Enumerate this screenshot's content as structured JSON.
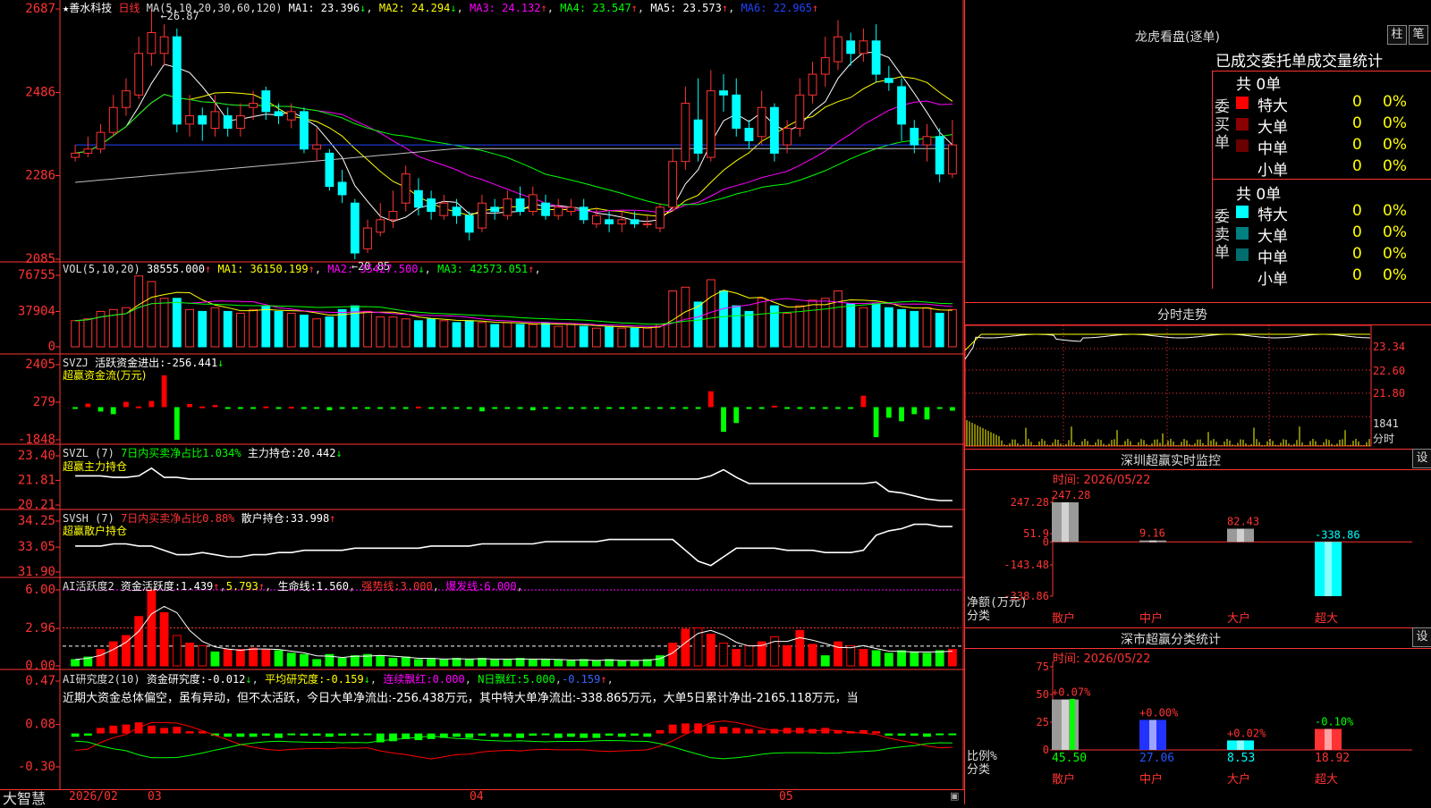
{
  "app": {
    "brand": "大智慧",
    "date_start": "2026/02",
    "months": [
      "03",
      "04",
      "05"
    ]
  },
  "price_pane": {
    "stock": "★善水科技",
    "period": "日线",
    "ma_label": "MA(5,10,20,30,60,120)",
    "ma": [
      {
        "k": "MA1:",
        "v": "23.396",
        "arrow": "↓",
        "color": "#ffffff"
      },
      {
        "k": "MA2:",
        "v": "24.294",
        "arrow": "↓",
        "color": "#ffff00"
      },
      {
        "k": "MA3:",
        "v": "24.132",
        "arrow": "↑",
        "color": "#ff00ff"
      },
      {
        "k": "MA4:",
        "v": "23.547",
        "arrow": "↑",
        "color": "#00ff00"
      },
      {
        "k": "MA5:",
        "v": "23.573",
        "arrow": "↑",
        "color": "#ffffff"
      },
      {
        "k": "MA6:",
        "v": "22.965",
        "arrow": "↑",
        "color": "#2244ff"
      }
    ],
    "y_ticks": [
      "2687",
      "2486",
      "2286",
      "2085"
    ],
    "high_label": "26.87",
    "low_label": "←20.85"
  },
  "vol_pane": {
    "label": "VOL(5,10,20)",
    "value": "38555.000",
    "ma": [
      {
        "k": "MA1:",
        "v": "36150.199",
        "arrow": "↑",
        "color": "#ffff00"
      },
      {
        "k": "MA2:",
        "v": "35427.500",
        "arrow": "↓",
        "color": "#ff00ff"
      },
      {
        "k": "MA3:",
        "v": "42573.051",
        "arrow": "↑",
        "color": "#00ff00"
      }
    ],
    "y_ticks": [
      "76755",
      "37904",
      "0"
    ]
  },
  "svzj_pane": {
    "name": "SVZJ",
    "label": "活跃资金进出:",
    "value": "-256.441",
    "arrow": "↓",
    "subtitle": "超赢资金流(万元)",
    "y_ticks": [
      "2405",
      "279",
      "-1848"
    ]
  },
  "svzl_pane": {
    "name": "SVZL",
    "period": "(7)",
    "desc": "7日内买卖净占比1.034%",
    "k": "主力持仓:",
    "v": "20.442",
    "arrow": "↓",
    "subtitle": "超赢主力持仓",
    "y_ticks": [
      "23.40",
      "21.81",
      "20.21"
    ]
  },
  "svsh_pane": {
    "name": "SVSH",
    "period": "(7)",
    "desc": "7日内买卖净占比0.88%",
    "k": "散户持仓:",
    "v": "33.998",
    "arrow": "↑",
    "subtitle": "超赢散户持仓",
    "y_ticks": [
      "34.25",
      "33.05",
      "31.90"
    ]
  },
  "ai_active_pane": {
    "name": "AI活跃度2",
    "k1": "资金活跃度:",
    "v1": "1.439",
    "v1b": "5.793",
    "k2": "生命线:",
    "v2": "1.560",
    "k3": "强势线:",
    "v3": "3.000",
    "k4": "爆发线:",
    "v4": "6.000",
    "y_ticks": [
      "6.00",
      "2.96",
      "0.00"
    ]
  },
  "ai_research_pane": {
    "name": "AI研究度2(10)",
    "k1": "资金研究度:",
    "v1": "-0.012",
    "k2": "平均研究度:",
    "v2": "-0.159",
    "k3": "连续飘红:",
    "v3": "0.000",
    "k4": "N日飘红:",
    "v4": "5.000",
    "v5": "-0.159",
    "narrative": "近期大资金总体偏空，虽有异动，但不太活跃，今日大单净流出:-256.438万元，其中特大单净流出:-338.865万元，大单5日累计净出-2165.118万元，当",
    "y_ticks": [
      "0.47",
      "0.08",
      "-0.30"
    ]
  },
  "dragon_panel": {
    "title": "龙虎看盘(逐单)",
    "btn_bar": "柱",
    "btn_pen": "笔",
    "header": "已成交委托单成交量统计",
    "buy_side": {
      "label": "委买单",
      "count": "共 0单",
      "rows": [
        {
          "name": "特大",
          "color": "#ff0000",
          "val": "0",
          "pct": "0%"
        },
        {
          "name": "大单",
          "color": "#8b0000",
          "val": "0",
          "pct": "0%"
        },
        {
          "name": "中单",
          "color": "#6a0000",
          "val": "0",
          "pct": "0%"
        },
        {
          "name": "小单",
          "color": "#000000",
          "val": "0",
          "pct": "0%"
        }
      ]
    },
    "sell_side": {
      "label": "委卖单",
      "count": "共 0单",
      "rows": [
        {
          "name": "特大",
          "color": "#00ffff",
          "val": "0",
          "pct": "0%"
        },
        {
          "name": "大单",
          "color": "#008080",
          "val": "0",
          "pct": "0%"
        },
        {
          "name": "中单",
          "color": "#006e6e",
          "val": "0",
          "pct": "0%"
        },
        {
          "name": "小单",
          "color": "#000000",
          "val": "0",
          "pct": "0%"
        }
      ]
    }
  },
  "intraday": {
    "title": "分时走势",
    "y_ticks": [
      "23.34",
      "22.60",
      "21.80"
    ],
    "vol_label": "1841",
    "vol_unit": "分时"
  },
  "sz_monitor": {
    "title": "深圳超赢实时监控",
    "btn": "设",
    "time_label": "时间: 2026/05/22",
    "y_ticks": [
      "247.28",
      "51.9",
      "0",
      "-143.48",
      "-338.86"
    ],
    "unit1": "净额(万元)",
    "unit2": "分类",
    "cats": [
      "散户",
      "中户",
      "大户",
      "超大"
    ],
    "vals": [
      247.28,
      9.16,
      82.43,
      -338.86
    ],
    "val_labels": [
      "247.28",
      "9.16",
      "82.43",
      "-338.86"
    ]
  },
  "sz_stats": {
    "title": "深市超赢分类统计",
    "btn": "设",
    "time_label": "时间: 2026/05/22",
    "y_ticks": [
      "75",
      "50",
      "25",
      "0"
    ],
    "unit1": "比例%",
    "unit2": "分类",
    "cats": [
      "散户",
      "中户",
      "大户",
      "超大"
    ],
    "vals": [
      45.5,
      27.06,
      8.53,
      18.92
    ],
    "val_labels": [
      "45.50",
      "27.06",
      "8.53",
      "18.92"
    ],
    "changes": [
      "+0.07%",
      "+0.00%",
      "+0.02%",
      "-0.10%"
    ]
  },
  "chart_data": {
    "type": "candlestick",
    "title": "★善水科技 日线",
    "x_labels": [
      "2026/02",
      "03",
      "04",
      "05"
    ],
    "price_ylim": [
      20.85,
      26.87
    ],
    "candles": [
      [
        23.3,
        23.4,
        23.6,
        23.2
      ],
      [
        23.4,
        23.5,
        23.8,
        23.3
      ],
      [
        23.5,
        23.9,
        24.1,
        23.4
      ],
      [
        23.9,
        24.5,
        24.8,
        23.8
      ],
      [
        24.5,
        24.9,
        25.2,
        24.3
      ],
      [
        24.8,
        25.8,
        26.2,
        24.7
      ],
      [
        25.8,
        26.3,
        26.87,
        25.5
      ],
      [
        25.8,
        26.2,
        26.5,
        25.5
      ],
      [
        26.2,
        24.1,
        26.4,
        23.9
      ],
      [
        24.1,
        24.3,
        24.8,
        23.8
      ],
      [
        24.3,
        24.1,
        24.5,
        23.7
      ],
      [
        24.0,
        24.4,
        24.8,
        23.8
      ],
      [
        24.3,
        24.0,
        24.5,
        23.8
      ],
      [
        24.0,
        24.3,
        24.6,
        23.8
      ],
      [
        24.5,
        24.6,
        24.9,
        24.2
      ],
      [
        24.9,
        24.4,
        25.0,
        24.2
      ],
      [
        24.4,
        24.3,
        24.6,
        24.1
      ],
      [
        24.2,
        24.4,
        24.6,
        24.0
      ],
      [
        24.4,
        23.5,
        24.5,
        23.4
      ],
      [
        23.5,
        23.6,
        24.0,
        23.2
      ],
      [
        23.4,
        22.6,
        23.5,
        22.5
      ],
      [
        22.7,
        22.4,
        23.0,
        22.2
      ],
      [
        22.2,
        21.0,
        22.3,
        20.85
      ],
      [
        21.1,
        21.6,
        21.8,
        21.0
      ],
      [
        21.5,
        21.8,
        22.2,
        21.4
      ],
      [
        21.8,
        22.0,
        22.5,
        21.6
      ],
      [
        22.2,
        22.9,
        23.1,
        22.0
      ],
      [
        22.5,
        22.1,
        22.8,
        21.9
      ],
      [
        22.3,
        22.0,
        22.5,
        21.8
      ],
      [
        21.9,
        22.2,
        22.4,
        21.8
      ],
      [
        22.1,
        21.9,
        22.3,
        21.7
      ],
      [
        21.9,
        21.5,
        22.0,
        21.3
      ],
      [
        21.6,
        22.2,
        22.4,
        21.5
      ],
      [
        22.1,
        22.0,
        22.3,
        21.8
      ],
      [
        21.9,
        22.3,
        22.5,
        21.8
      ],
      [
        22.3,
        22.0,
        22.6,
        21.9
      ],
      [
        22.0,
        22.4,
        22.6,
        21.9
      ],
      [
        22.2,
        21.9,
        22.4,
        21.8
      ],
      [
        21.9,
        22.1,
        22.3,
        21.8
      ],
      [
        22.0,
        22.1,
        22.3,
        21.9
      ],
      [
        22.1,
        21.8,
        22.3,
        21.7
      ],
      [
        21.7,
        21.9,
        22.1,
        21.6
      ],
      [
        21.8,
        21.7,
        22.0,
        21.5
      ],
      [
        21.7,
        21.8,
        22.0,
        21.5
      ],
      [
        21.8,
        21.7,
        22.0,
        21.6
      ],
      [
        21.7,
        21.7,
        21.9,
        21.6
      ],
      [
        21.6,
        22.1,
        22.2,
        21.5
      ],
      [
        22.1,
        23.2,
        23.5,
        22.0
      ],
      [
        23.2,
        24.6,
        25.0,
        23.0
      ],
      [
        24.2,
        23.4,
        25.2,
        23.2
      ],
      [
        23.3,
        24.9,
        25.4,
        23.2
      ],
      [
        24.9,
        24.8,
        25.3,
        24.4
      ],
      [
        24.8,
        24.0,
        25.2,
        23.8
      ],
      [
        24.0,
        23.7,
        24.2,
        23.5
      ],
      [
        23.8,
        24.5,
        24.9,
        23.6
      ],
      [
        24.5,
        23.4,
        24.6,
        23.2
      ],
      [
        23.6,
        24.0,
        24.2,
        23.4
      ],
      [
        24.0,
        24.8,
        25.2,
        23.8
      ],
      [
        24.8,
        25.3,
        25.6,
        24.6
      ],
      [
        25.3,
        25.7,
        26.2,
        25.0
      ],
      [
        25.6,
        26.2,
        26.6,
        25.4
      ],
      [
        26.1,
        25.8,
        26.3,
        25.5
      ],
      [
        25.8,
        26.1,
        26.4,
        25.6
      ],
      [
        26.1,
        25.3,
        26.5,
        25.1
      ],
      [
        25.2,
        25.1,
        25.5,
        24.9
      ],
      [
        25.0,
        24.1,
        25.2,
        23.7
      ],
      [
        24.0,
        23.6,
        24.2,
        23.4
      ],
      [
        23.6,
        23.8,
        24.1,
        23.2
      ],
      [
        23.8,
        22.9,
        24.0,
        22.7
      ],
      [
        22.9,
        23.6,
        24.2,
        22.8
      ]
    ],
    "volume_ylim": [
      0,
      76755
    ],
    "volume": [
      28,
      30,
      38,
      40,
      42,
      76,
      70,
      52,
      52,
      40,
      38,
      42,
      38,
      36,
      40,
      44,
      38,
      36,
      34,
      30,
      32,
      40,
      44,
      38,
      32,
      32,
      30,
      28,
      30,
      28,
      26,
      28,
      26,
      24,
      26,
      24,
      24,
      26,
      22,
      24,
      22,
      20,
      22,
      20,
      20,
      20,
      24,
      60,
      64,
      48,
      72,
      60,
      44,
      38,
      52,
      44,
      36,
      44,
      50,
      52,
      60,
      46,
      42,
      46,
      42,
      40,
      38,
      42,
      36,
      40
    ],
    "svzj_ylim": [
      -1848,
      2405
    ],
    "svzj": [
      -30,
      200,
      -250,
      -400,
      300,
      40,
      350,
      1800,
      -1848,
      180,
      40,
      120,
      -50,
      -60,
      -80,
      40,
      -30,
      20,
      -50,
      -50,
      -180,
      -30,
      -50,
      -60,
      -90,
      -70,
      -80,
      30,
      -30,
      -60,
      -90,
      -30,
      -240,
      -50,
      -60,
      -60,
      -180,
      -60,
      -50,
      -70,
      -80,
      -60,
      -70,
      -50,
      -60,
      -40,
      -60,
      -50,
      -50,
      -90,
      900,
      -1400,
      -900,
      -100,
      -90,
      80,
      -90,
      -40,
      -90,
      -80,
      -60,
      -50,
      650,
      -1700,
      -600,
      -800,
      -400,
      -700,
      -60,
      -200
    ],
    "svzl_ylim": [
      20.21,
      23.4
    ],
    "svzl": [
      22.1,
      22.1,
      22.1,
      22.0,
      22.0,
      22.1,
      22.6,
      22.0,
      22.0,
      21.9,
      21.9,
      21.9,
      21.9,
      21.9,
      21.9,
      21.9,
      21.9,
      21.9,
      21.9,
      21.9,
      21.9,
      21.9,
      21.9,
      21.9,
      21.9,
      21.9,
      21.9,
      21.9,
      21.9,
      21.9,
      21.9,
      21.9,
      21.9,
      21.9,
      21.9,
      21.9,
      21.9,
      21.9,
      21.9,
      21.9,
      21.9,
      21.9,
      21.9,
      21.9,
      21.9,
      21.9,
      21.9,
      21.9,
      21.9,
      21.9,
      22.1,
      22.5,
      22.0,
      21.6,
      21.6,
      21.6,
      21.6,
      21.6,
      21.6,
      21.6,
      21.6,
      21.6,
      21.6,
      21.7,
      21.1,
      21.0,
      20.8,
      20.6,
      20.5,
      20.5
    ],
    "svsh_ylim": [
      31.9,
      34.25
    ],
    "svsh": [
      33.1,
      33.1,
      33.1,
      33.2,
      33.2,
      33.1,
      33.1,
      32.9,
      32.7,
      32.7,
      32.8,
      32.7,
      32.6,
      32.6,
      32.7,
      32.7,
      32.8,
      32.8,
      32.9,
      32.9,
      32.9,
      32.9,
      33.0,
      33.0,
      33.0,
      33.0,
      33.0,
      33.0,
      33.1,
      33.1,
      33.1,
      33.1,
      33.2,
      33.2,
      33.2,
      33.2,
      33.2,
      33.3,
      33.3,
      33.3,
      33.3,
      33.3,
      33.4,
      33.4,
      33.4,
      33.4,
      33.4,
      33.4,
      32.9,
      32.4,
      32.2,
      32.6,
      33.0,
      33.0,
      33.0,
      33.0,
      32.9,
      32.9,
      32.9,
      32.8,
      32.8,
      32.8,
      32.9,
      33.6,
      33.8,
      33.9,
      34.1,
      34.1,
      34.0,
      34.0
    ],
    "ai_active_ylim": [
      0,
      6.0
    ],
    "ai_active": [
      0.5,
      0.7,
      1.3,
      1.9,
      2.4,
      3.9,
      6.0,
      4.2,
      2.4,
      1.8,
      1.6,
      1.1,
      1.3,
      1.3,
      1.4,
      1.3,
      1.2,
      1.0,
      0.9,
      0.5,
      0.9,
      0.6,
      0.8,
      0.9,
      0.8,
      0.6,
      0.7,
      0.5,
      0.6,
      0.5,
      0.6,
      0.5,
      0.6,
      0.5,
      0.5,
      0.6,
      0.5,
      0.5,
      0.5,
      0.4,
      0.5,
      0.4,
      0.5,
      0.4,
      0.4,
      0.5,
      0.8,
      1.8,
      2.9,
      3.0,
      2.5,
      1.8,
      1.3,
      1.6,
      1.9,
      2.3,
      1.6,
      2.8,
      1.7,
      0.8,
      1.9,
      1.6,
      1.3,
      1.2,
      1.0,
      1.2,
      1.1,
      1.0,
      1.2,
      1.3
    ],
    "ai_research_ylim": [
      -0.3,
      0.47
    ],
    "ai_research": [
      -0.03,
      -0.02,
      0.05,
      0.07,
      0.08,
      0.1,
      0.07,
      0.05,
      0.06,
      0.02,
      0.02,
      -0.02,
      -0.03,
      -0.03,
      -0.03,
      -0.02,
      -0.04,
      -0.01,
      -0.02,
      -0.02,
      -0.03,
      -0.02,
      -0.02,
      -0.01,
      -0.08,
      -0.07,
      -0.05,
      -0.06,
      -0.05,
      -0.04,
      -0.03,
      -0.04,
      -0.02,
      -0.03,
      -0.03,
      -0.04,
      -0.02,
      -0.01,
      -0.04,
      -0.03,
      -0.04,
      -0.04,
      -0.02,
      -0.03,
      -0.02,
      -0.03,
      0.03,
      0.08,
      0.09,
      0.09,
      0.08,
      0.06,
      0.05,
      0.04,
      0.03,
      0.04,
      0.05,
      0.05,
      0.04,
      0.05,
      0.03,
      0.02,
      0.03,
      0.02,
      -0.02,
      -0.02,
      -0.02,
      -0.03,
      -0.01,
      -0.01
    ]
  }
}
